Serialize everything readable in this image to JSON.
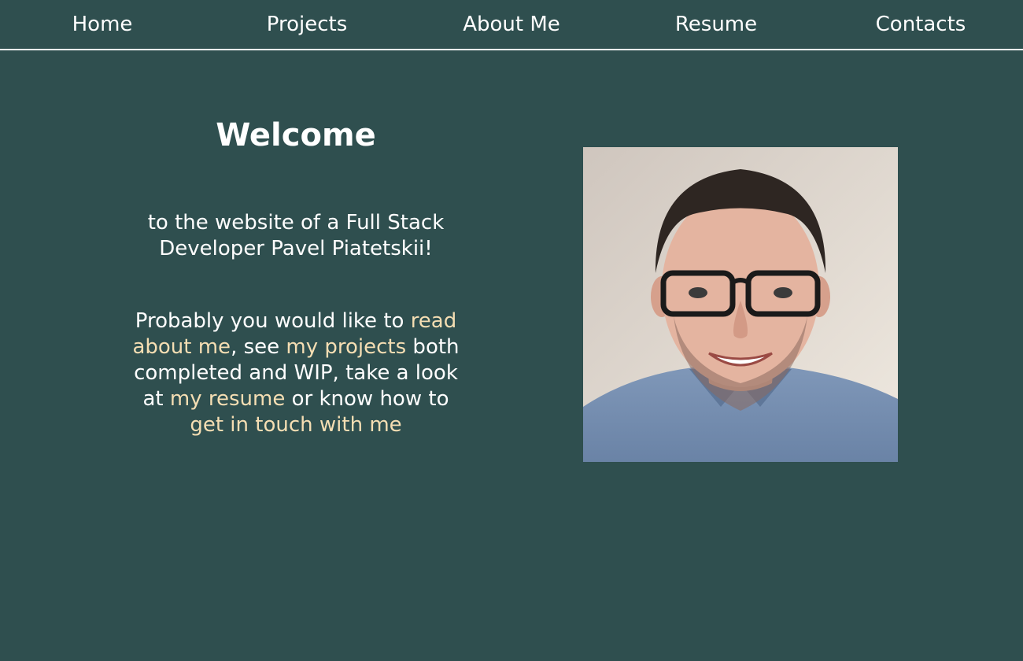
{
  "nav": {
    "items": [
      {
        "label": "Home"
      },
      {
        "label": "Projects"
      },
      {
        "label": "About Me"
      },
      {
        "label": "Resume"
      },
      {
        "label": "Contacts"
      }
    ]
  },
  "main": {
    "title": "Welcome",
    "subtitle": "to the website of a Full Stack Developer Pavel Piatetskii!",
    "intro": {
      "text_1": "Probably you would like to ",
      "link_about": "read about me",
      "text_2": ", see ",
      "link_projects": "my projects",
      "text_3": " both completed and WIP, take a look at ",
      "link_resume": "my resume",
      "text_4": " or know how to ",
      "link_contact": "get in touch with me"
    }
  },
  "photo": {
    "icon": "profile-photo-portrait"
  },
  "colors": {
    "background": "#2f4f4f",
    "text": "#ffffff",
    "link": "#f5deb3",
    "divider": "#ffffff"
  }
}
